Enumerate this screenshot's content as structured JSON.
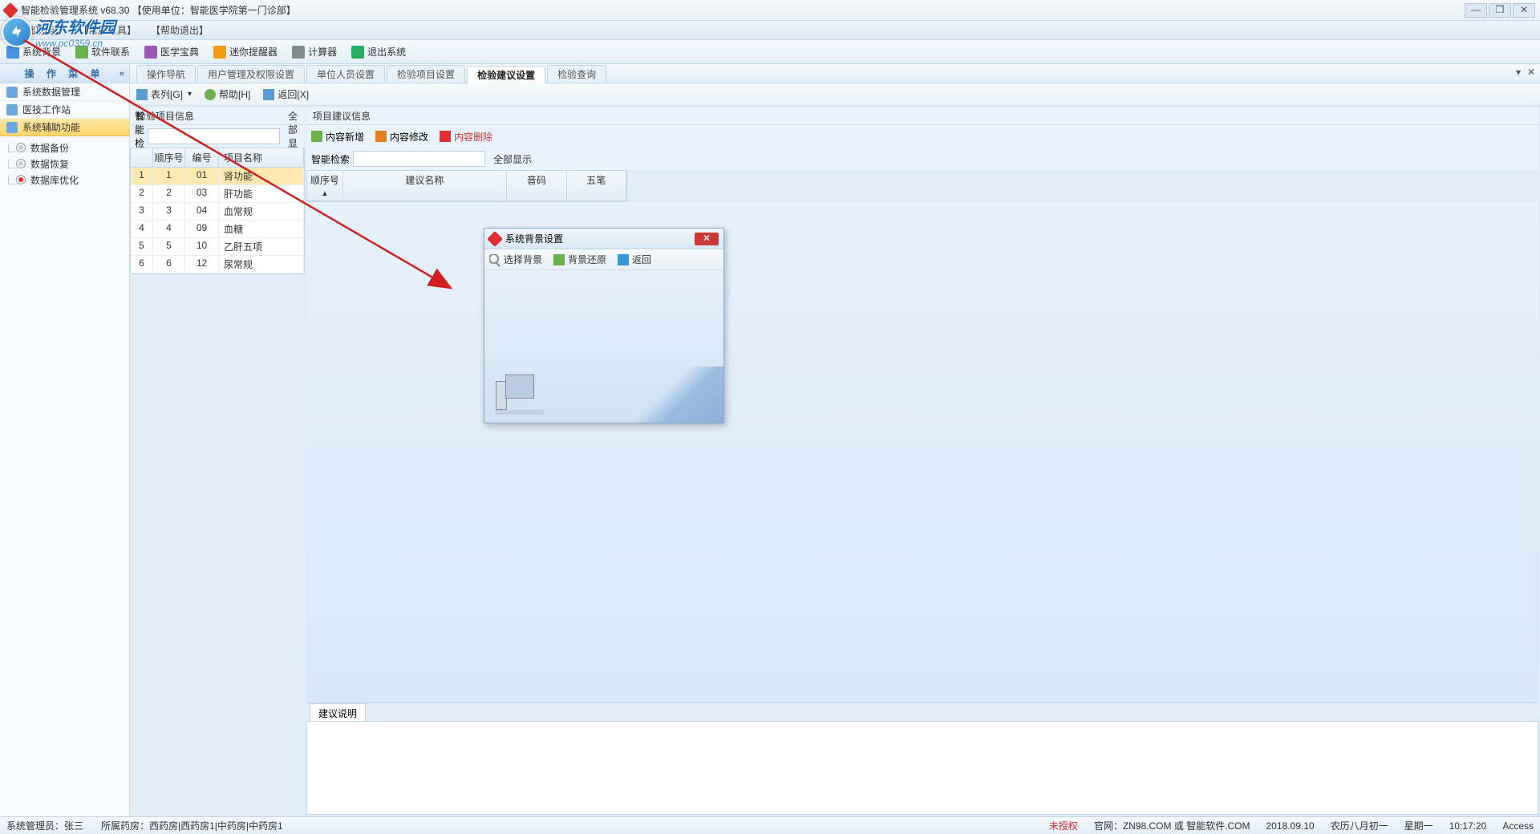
{
  "title": "智能检验管理系统 v68.30      【使用单位：智能医学院第一门诊部】",
  "menus": {
    "m1": "【基础功能】",
    "m2": "【常用工具】",
    "m3": "【帮助退出】"
  },
  "toolbar": {
    "t1": "系统背景",
    "t2": "软件联系",
    "t3": "医学宝典",
    "t4": "迷你提醒器",
    "t5": "计算器",
    "t6": "退出系统"
  },
  "watermark": {
    "zh": "河东软件园",
    "url": "www.pc0359.cn"
  },
  "sidebar": {
    "header": "操 作 菜 单",
    "item1": "系统数据管理",
    "item2": "医技工作站",
    "item3": "系统辅助功能",
    "tree": {
      "a": "数据备份",
      "b": "数据恢复",
      "c": "数据库优化"
    }
  },
  "tabs": {
    "t1": "操作导航",
    "t2": "用户管理及权限设置",
    "t3": "单位人员设置",
    "t4": "检验项目设置",
    "t5": "检验建议设置",
    "t6": "检验查询"
  },
  "subtb": {
    "b1": "表列[G]",
    "b2": "帮助[H]",
    "b3": "返回[X]"
  },
  "leftPanel": {
    "title": "检验项目信息",
    "searchLabel": "智能检索",
    "showAll": "全部显示",
    "cols": {
      "seq": "顺序号",
      "code": "编号",
      "name": "项目名称"
    },
    "rows": [
      {
        "i": "1",
        "seq": "1",
        "code": "01",
        "name": "肾功能"
      },
      {
        "i": "2",
        "seq": "2",
        "code": "03",
        "name": "肝功能"
      },
      {
        "i": "3",
        "seq": "3",
        "code": "04",
        "name": "血常规"
      },
      {
        "i": "4",
        "seq": "4",
        "code": "09",
        "name": "血糖"
      },
      {
        "i": "5",
        "seq": "5",
        "code": "10",
        "name": "乙肝五项"
      },
      {
        "i": "6",
        "seq": "6",
        "code": "12",
        "name": "尿常规"
      }
    ]
  },
  "rightPanel": {
    "title": "项目建议信息",
    "actions": {
      "add": "内容新增",
      "edit": "内容修改",
      "del": "内容删除"
    },
    "searchLabel": "智能检索",
    "showAll": "全部显示",
    "cols": {
      "seq": "顺序号",
      "name": "建议名称",
      "py": "音码",
      "wb": "五笔"
    },
    "descTab": "建议说明"
  },
  "dialog": {
    "title": "系统背景设置",
    "b1": "选择背景",
    "b2": "背景还原",
    "b3": "返回"
  },
  "status": {
    "admin": "系统管理员：张三",
    "dept": "所属药房：西药房|西药房1|中药房|中药房1",
    "auth": "未授权",
    "site": "官网：ZN98.COM 或 智能软件.COM",
    "date": "2018.09.10",
    "lunar": "农历八月初一",
    "week": "星期一",
    "time": "10:17:20",
    "db": "Access"
  }
}
